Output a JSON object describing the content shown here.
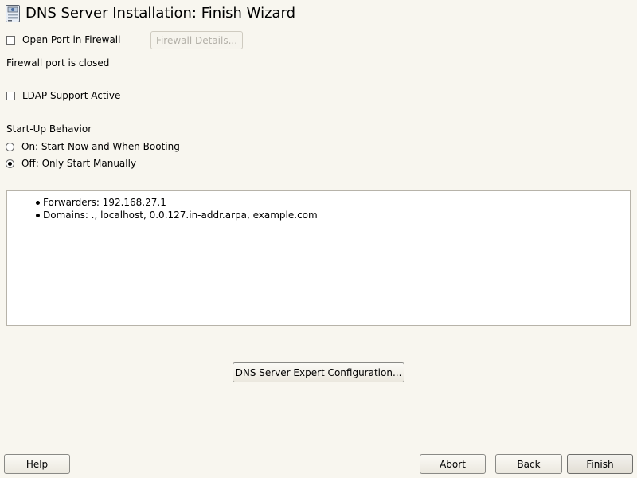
{
  "window": {
    "title": "DNS Server Installation: Finish Wizard"
  },
  "firewall": {
    "open_port_label": "Open Port in Firewall",
    "open_port_checked": false,
    "details_button_label": "Firewall Details...",
    "status_text": "Firewall port is closed"
  },
  "ldap": {
    "label": "LDAP Support Active",
    "checked": false
  },
  "startup": {
    "heading": "Start-Up Behavior",
    "options": [
      {
        "label": "On: Start Now and When Booting",
        "selected": false
      },
      {
        "label": "Off: Only Start Manually",
        "selected": true
      }
    ]
  },
  "summary": {
    "items": [
      "Forwarders: 192.168.27.1",
      "Domains: ., localhost, 0.0.127.in-addr.arpa, example.com"
    ]
  },
  "expert_button_label": "DNS Server Expert Configuration...",
  "footer": {
    "help_label": "Help",
    "abort_label": "Abort",
    "back_label": "Back",
    "finish_label": "Finish"
  }
}
